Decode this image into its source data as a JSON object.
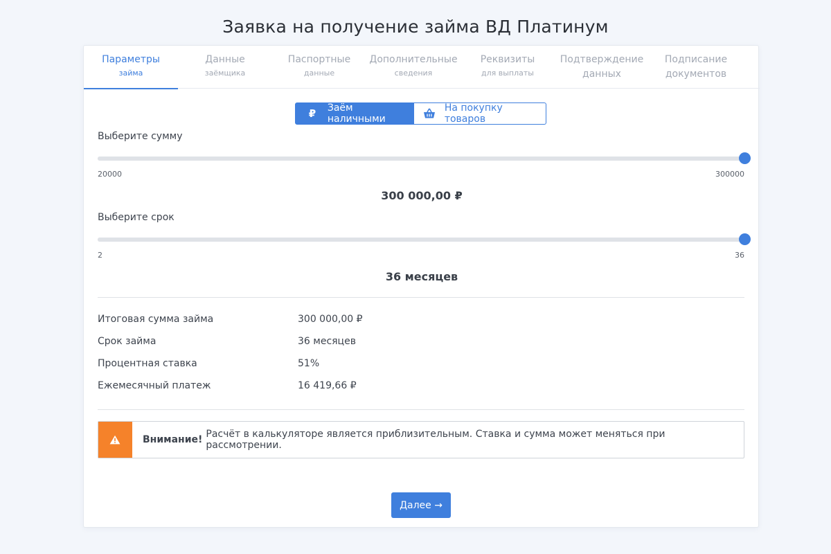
{
  "page": {
    "title": "Заявка на получение займа ВД Платинум"
  },
  "steps": [
    {
      "main": "Параметры",
      "sub": "займа",
      "active": true
    },
    {
      "main": "Данные",
      "sub": "заёмщика",
      "active": false
    },
    {
      "main": "Паспортные",
      "sub": "данные",
      "active": false
    },
    {
      "main": "Дополнительные",
      "sub": "сведения",
      "active": false
    },
    {
      "main": "Реквизиты",
      "sub": "для выплаты",
      "active": false
    },
    {
      "main": "Подтверждение",
      "sub": "данных",
      "active": false
    },
    {
      "main": "Подписание",
      "sub": "документов",
      "active": false
    }
  ],
  "loan_type": {
    "cash_label": "Заём наличными",
    "cash_icon": "ruble-icon",
    "goods_label": "На покупку товаров",
    "goods_icon": "basket-icon",
    "selected": "cash"
  },
  "amount": {
    "label": "Выберите сумму",
    "min": "20000",
    "max": "300000",
    "value_fraction": 1.0,
    "display": "300 000,00 ₽"
  },
  "term": {
    "label": "Выберите срок",
    "min": "2",
    "max": "36",
    "value_fraction": 1.0,
    "display": "36 месяцев"
  },
  "summary": [
    {
      "key": "Итоговая сумма займа",
      "value": "300 000,00 ₽"
    },
    {
      "key": "Срок займа",
      "value": "36 месяцев"
    },
    {
      "key": "Процентная ставка",
      "value": "51%"
    },
    {
      "key": "Ежемесячный платеж",
      "value": "16 419,66 ₽"
    }
  ],
  "alert": {
    "icon": "warning-icon",
    "bold": "Внимание!",
    "text": "Расчёт в калькуляторе является приблизительным. Ставка и сумма может меняться при рассмотрении."
  },
  "next_button": {
    "label": "Далее →"
  },
  "colors": {
    "accent": "#3f7fdd",
    "warning": "#f5822a",
    "background": "#f3f6fb"
  }
}
